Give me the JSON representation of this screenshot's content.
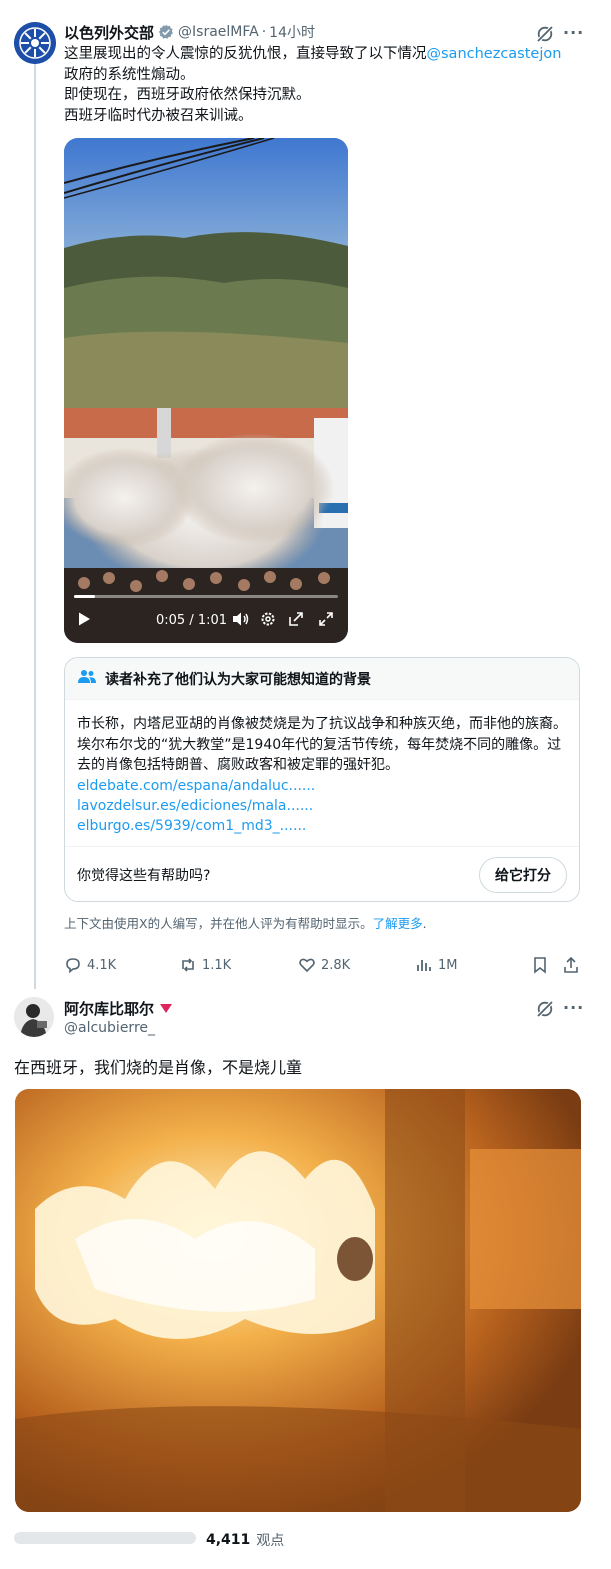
{
  "tweet1": {
    "author_name": "以色列外交部",
    "handle": "@IsraelMFA",
    "separator": "·",
    "time": "14小时",
    "text_line1": "这里展现出的令人震惊的反犹仇恨，直接导致了以下情况",
    "mention": "@sanchezcastejon",
    "text_line2": "政府的系统性煽动。",
    "text_line3": "即使现在，西班牙政府依然保持沉默。",
    "text_line4": "西班牙临时代办被召来训诫。",
    "video": {
      "time": "0:05 / 1:01",
      "progress": 0.08
    },
    "note": {
      "title": "读者补充了他们认为大家可能想知道的背景",
      "body": "市长称，内塔尼亚胡的肖像被焚烧是为了抗议战争和种族灭绝，而非他的族裔。埃尔布尔戈的“犹大教堂”是1940年代的复活节传统，每年焚烧不同的雕像。过去的肖像包括特朗普、腐败政客和被定罪的强奸犯。",
      "links": [
        "eldebate.com/espana/andaluc......",
        "lavozdelsur.es/ediciones/mala......",
        "elburgo.es/5939/com1_md3_......"
      ],
      "question": "你觉得这些有帮助吗?",
      "rate_button": "给它打分"
    },
    "disclaimer": "上下文由使用X的人编写，并在他人评为有帮助时显示。",
    "learn_more": "了解更多",
    "disclaimer_end": ".",
    "actions": {
      "replies": "4.1K",
      "reposts": "1.1K",
      "likes": "2.8K",
      "views": "1M"
    }
  },
  "tweet2": {
    "author_name": "阿尔库比耶尔",
    "handle": "@alcubierre_",
    "text": "在西班牙，我们烧的是肖像，不是烧儿童",
    "views_count": "4,411",
    "views_label": "观点"
  },
  "colors": {
    "link": "#1d9bf0",
    "muted": "#536471",
    "text": "#0f1419",
    "verified": "#829aab",
    "badge_red": "#e0245e"
  }
}
